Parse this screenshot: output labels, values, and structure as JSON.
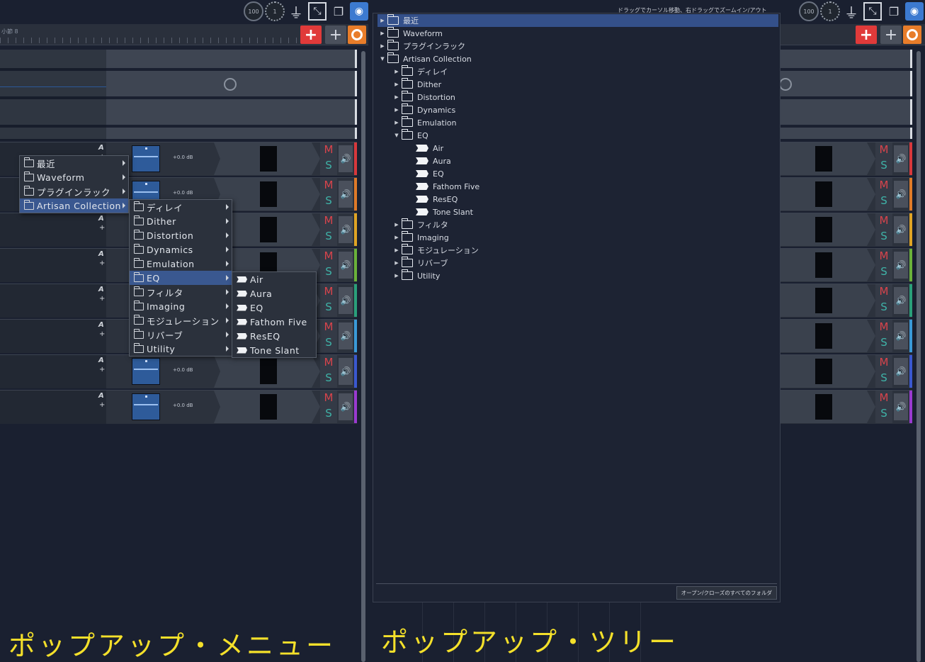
{
  "topbar": {
    "knob_value": "100",
    "knob_small_value": "1",
    "hint": "ドラッグでカーソル移動、右ドラッグでズームイン/アウト"
  },
  "ruler": {
    "label": "小節 8"
  },
  "buttons": {
    "add_red": "+",
    "add_grey": "+"
  },
  "track": {
    "auto_label": "A",
    "add_label": "+",
    "db": "+0.0 dB",
    "mute": "M",
    "solo": "S",
    "speaker": "🔊"
  },
  "track_colors": [
    "#d8383c",
    "#e07a28",
    "#e0a424",
    "#6ab23a",
    "#2aa07a",
    "#3a9ad8",
    "#3a58d0",
    "#9a3ad0"
  ],
  "menu": {
    "level1": [
      "最近",
      "Waveform",
      "プラグインラック",
      "Artisan Collection"
    ],
    "level2": [
      "ディレイ",
      "Dither",
      "Distortion",
      "Dynamics",
      "Emulation",
      "EQ",
      "フィルタ",
      "Imaging",
      "モジュレーション",
      "リバーブ",
      "Utility"
    ],
    "level3": [
      "Air",
      "Aura",
      "EQ",
      "Fathom Five",
      "ResEQ",
      "Tone Slant"
    ]
  },
  "tree": {
    "root": [
      "最近",
      "Waveform",
      "プラグインラック",
      "Artisan Collection"
    ],
    "artisan": [
      "ディレイ",
      "Dither",
      "Distortion",
      "Dynamics",
      "Emulation",
      "EQ"
    ],
    "eq_items": [
      "Air",
      "Aura",
      "EQ",
      "Fathom Five",
      "ResEQ",
      "Tone Slant"
    ],
    "after": [
      "フィルタ",
      "Imaging",
      "モジュレーション",
      "リバーブ",
      "Utility"
    ],
    "footer_button": "オープン/クローズのすべてのフォルダ"
  },
  "captions": {
    "left": "ポップアップ・メニュー",
    "right": "ポップアップ・ツリー"
  }
}
